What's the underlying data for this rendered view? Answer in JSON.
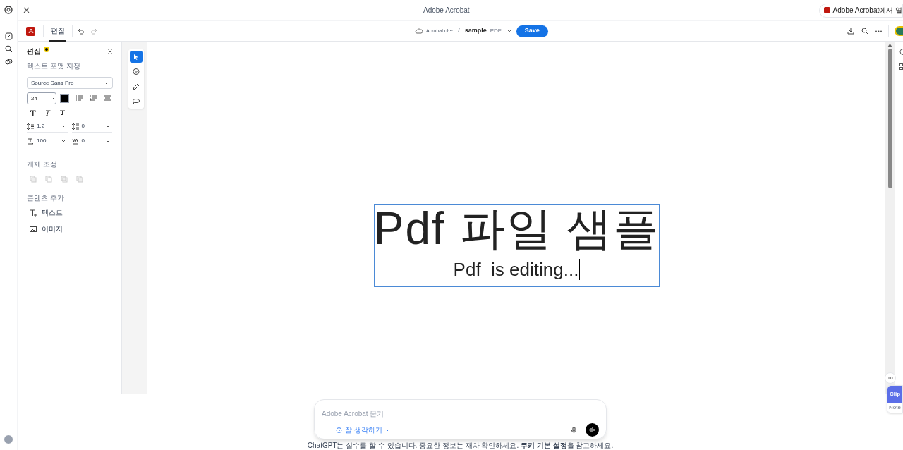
{
  "window": {
    "title": "Adobe Acrobat",
    "open_button": "Adobe Acrobat에서 열"
  },
  "toolbar": {
    "tabs": [
      {
        "label": "편집",
        "selected": true
      }
    ],
    "breadcrumb": "Acrobat cl···",
    "separator": "/",
    "file_name": "sample",
    "file_type": "PDF",
    "save": "Save"
  },
  "panel": {
    "title": "편집",
    "format_heading": "텍스트 포맷 지정",
    "font": "Source Sans Pro",
    "size": "24",
    "color": "#000000",
    "spacing": [
      {
        "kind": "line",
        "value": "1.2"
      },
      {
        "kind": "paragraph",
        "value": "0"
      },
      {
        "kind": "scale",
        "value": "100"
      },
      {
        "kind": "tracking",
        "value": "0"
      }
    ],
    "arrange_heading": "개체 조정",
    "add_heading": "콘텐츠 추가",
    "add_items": [
      {
        "kind": "text",
        "label": "텍스트"
      },
      {
        "kind": "image",
        "label": "이미지"
      }
    ]
  },
  "tools": [
    {
      "kind": "select",
      "selected": true
    },
    {
      "kind": "comment",
      "selected": false
    },
    {
      "kind": "draw",
      "selected": false
    },
    {
      "kind": "lasso",
      "selected": false
    }
  ],
  "document": {
    "heading": "Pdf 파일 샘플",
    "line": "Pdf  is editing..."
  },
  "chat": {
    "placeholder": "Adobe Acrobat 묻기",
    "mode": "잘 생각하기",
    "disclaimer": "ChatGPT는 실수를 할 수 있습니다. 중요한 정보는 재차 확인하세요. **쿠키 기본 설정**을 참고하세요."
  },
  "side_clip": {
    "clip": "Clip",
    "note": "Note"
  }
}
